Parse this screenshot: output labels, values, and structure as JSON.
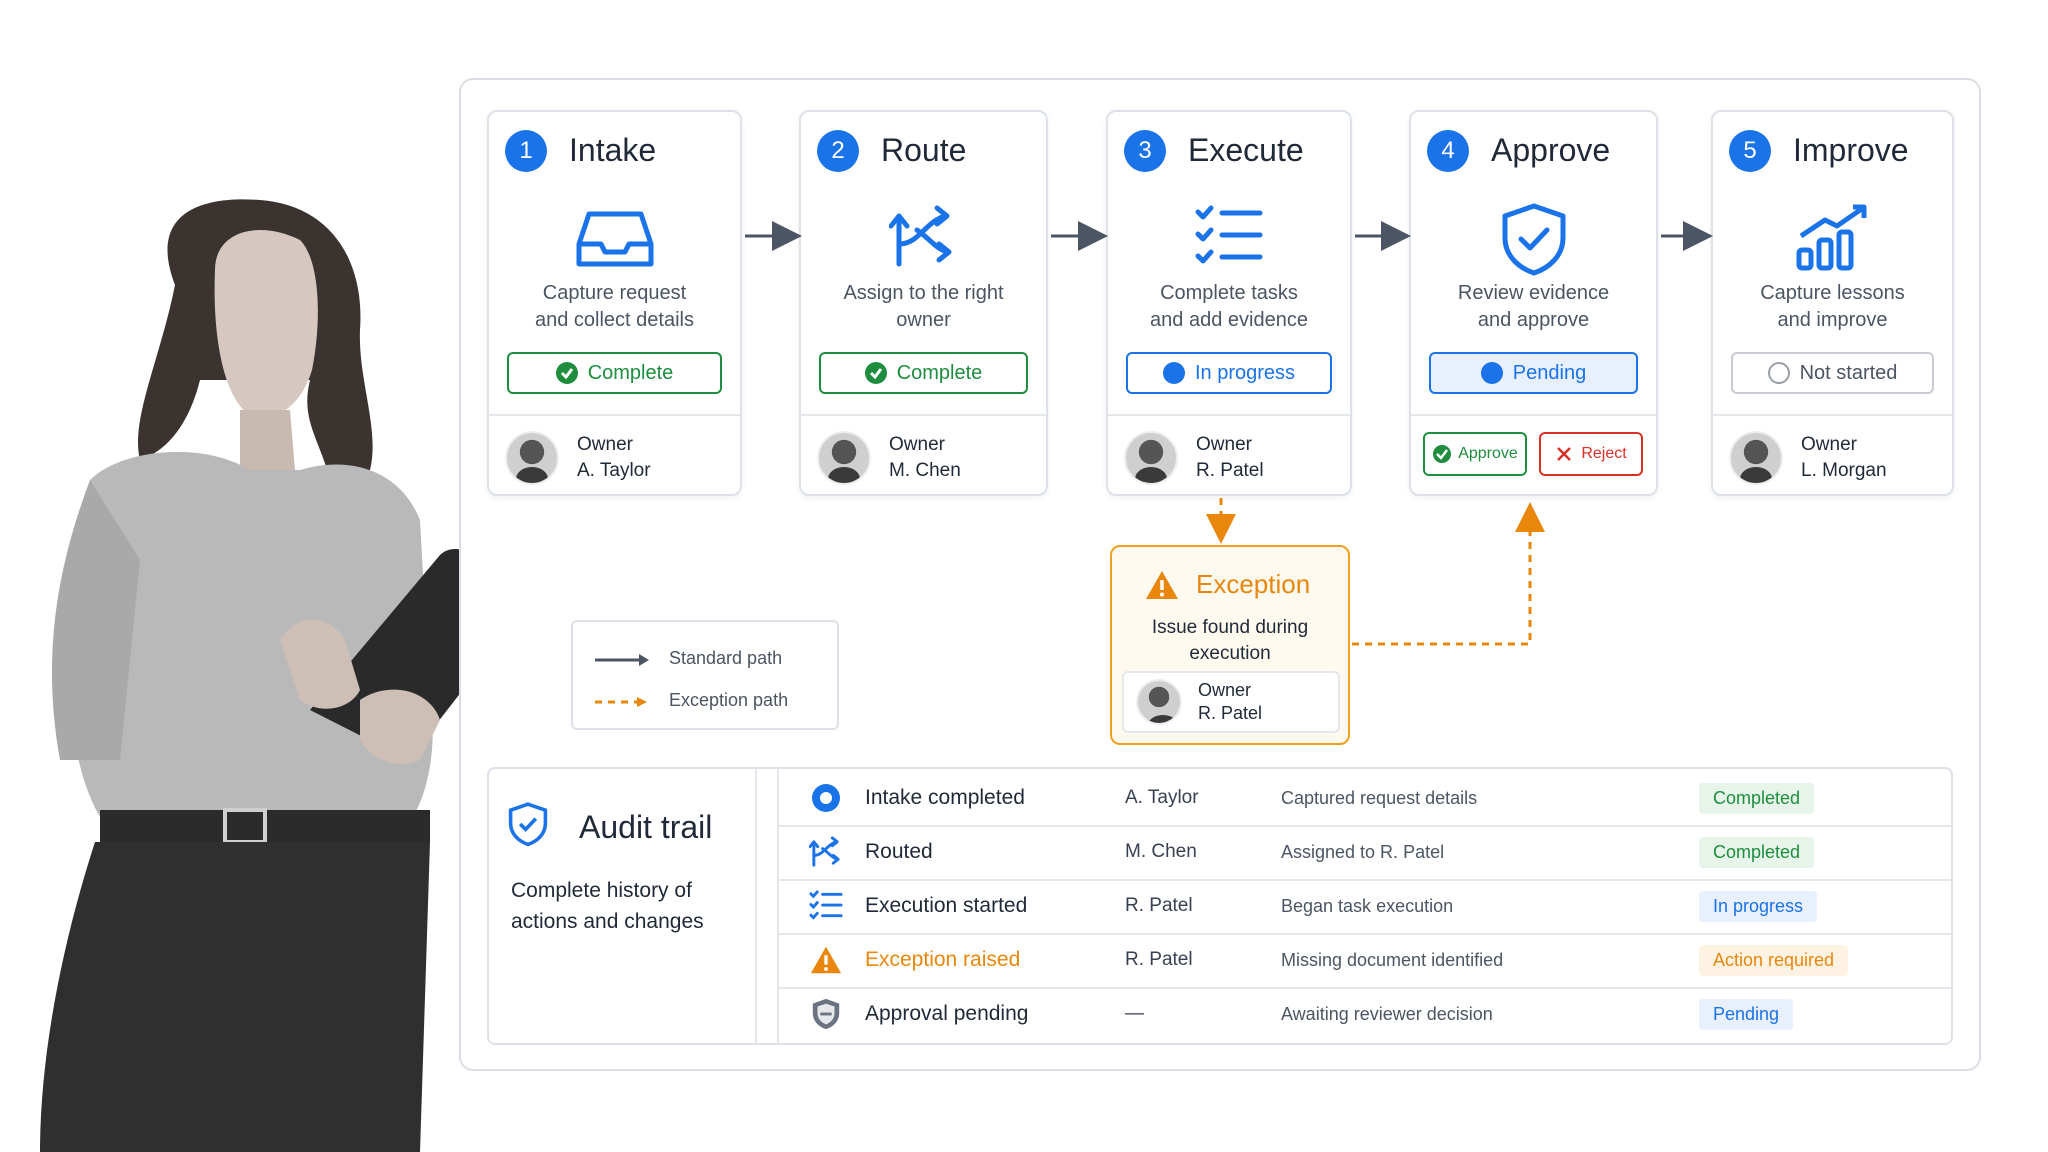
{
  "steps": [
    {
      "num": "1",
      "title": "Intake",
      "icon": "inbox-tray-icon",
      "desc1": "Capture request",
      "desc2": "and collect details",
      "status": "Complete",
      "owner_label": "Owner",
      "owner_name": "A. Taylor"
    },
    {
      "num": "2",
      "title": "Route",
      "icon": "route-arrows-icon",
      "desc1": "Assign to the right",
      "desc2": "owner",
      "status": "Complete",
      "owner_label": "Owner",
      "owner_name": "M. Chen"
    },
    {
      "num": "3",
      "title": "Execute",
      "icon": "checklist-icon",
      "desc1": "Complete tasks",
      "desc2": "and add evidence",
      "status": "In progress",
      "owner_label": "Owner",
      "owner_name": "R. Patel"
    },
    {
      "num": "4",
      "title": "Approve",
      "icon": "shield-check-icon",
      "desc1": "Review evidence",
      "desc2": "and approve",
      "status": "Pending",
      "approve_label": "Approve",
      "reject_label": "Reject"
    },
    {
      "num": "5",
      "title": "Improve",
      "icon": "growth-chart-icon",
      "desc1": "Capture lessons",
      "desc2": "and improve",
      "status": "Not started",
      "owner_label": "Owner",
      "owner_name": "L. Morgan"
    }
  ],
  "exception": {
    "title": "Exception",
    "desc1": "Issue found during",
    "desc2": "execution",
    "owner_label": "Owner",
    "owner_name": "R. Patel"
  },
  "legend": {
    "standard": "Standard path",
    "exception": "Exception path"
  },
  "audit": {
    "title": "Audit trail",
    "desc1": "Complete history of",
    "desc2": "actions and changes",
    "rows": [
      {
        "event": "Intake completed",
        "who": "A. Taylor",
        "detail": "Captured request details",
        "status": "Completed"
      },
      {
        "event": "Routed",
        "who": "M. Chen",
        "detail": "Assigned to R. Patel",
        "status": "Completed"
      },
      {
        "event": "Execution started",
        "who": "R. Patel",
        "detail": "Began task execution",
        "status": "In progress"
      },
      {
        "event": "Exception raised",
        "who": "R. Patel",
        "detail": "Missing document identified",
        "status": "Action required"
      },
      {
        "event": "Approval pending",
        "who": "—",
        "detail": "Awaiting reviewer decision",
        "status": "Pending"
      }
    ]
  },
  "colors": {
    "blue": "#1a73e8",
    "green": "#1e8e3e",
    "orange": "#e8870c",
    "red": "#d93025",
    "arrow": "#4b5563"
  }
}
